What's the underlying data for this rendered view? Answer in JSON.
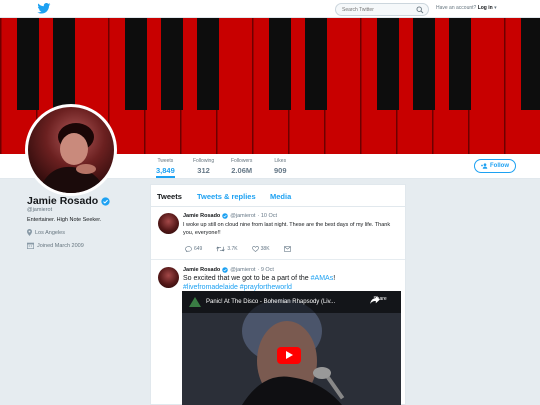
{
  "nav": {
    "search_placeholder": "Search Twitter",
    "login_prompt": "Have an account?",
    "login_label": "Log in"
  },
  "colors": {
    "accent": "#1da1f2",
    "banner": "#c20000"
  },
  "profile": {
    "name": "Jamie Rosado",
    "handle": "@jamierot",
    "bio": "Entertainer. High Note Seeker.",
    "location": "Los Angeles",
    "joined": "Joined March 2009"
  },
  "stats": [
    {
      "label": "Tweets",
      "value": "3,849"
    },
    {
      "label": "Following",
      "value": "312"
    },
    {
      "label": "Followers",
      "value": "2.06M"
    },
    {
      "label": "Likes",
      "value": "909"
    }
  ],
  "follow_label": "Follow",
  "tabs": [
    "Tweets",
    "Tweets & replies",
    "Media"
  ],
  "tweets": [
    {
      "name": "Jamie Rosado",
      "handle": "@jamierot",
      "date": "· 10 Oct",
      "text": "I woke up still on cloud nine from last night. These are the best days of my life. Thank you, everyone!!",
      "replies": "649",
      "retweets": "3.7K",
      "likes": "38K"
    },
    {
      "name": "Jamie Rosado",
      "handle": "@jamierot",
      "date": "· 9 Oct",
      "text_before": "So excited that we got to be a part of the ",
      "hashtag1": "#AMAs",
      "text_after": "!",
      "hashtag2": "#livefromadelaide #prayfortheworld",
      "video_title": "Panic! At The Disco - Bohemian Rhapsody (Liv...",
      "video_share": "Share"
    }
  ]
}
